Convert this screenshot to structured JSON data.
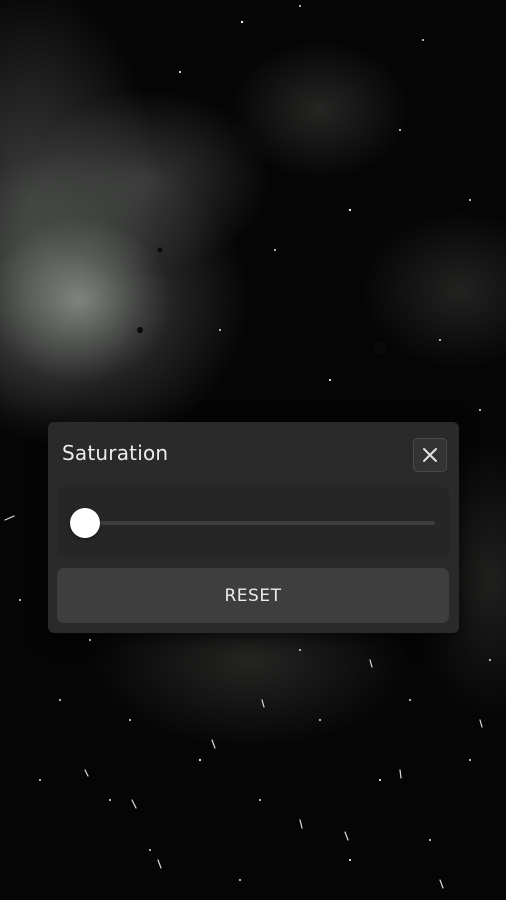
{
  "dialog": {
    "title": "Saturation",
    "close_icon": "close-x-icon",
    "reset_label": "RESET"
  },
  "slider": {
    "value": 0.0,
    "min": 0.0,
    "max": 1.0
  },
  "colors": {
    "background": "#050505",
    "dialog_bg": "#2a2a2a",
    "slider_panel_bg": "#262626",
    "button_bg": "#3e3e3e",
    "thumb": "#ffffff",
    "text": "#ededed"
  }
}
